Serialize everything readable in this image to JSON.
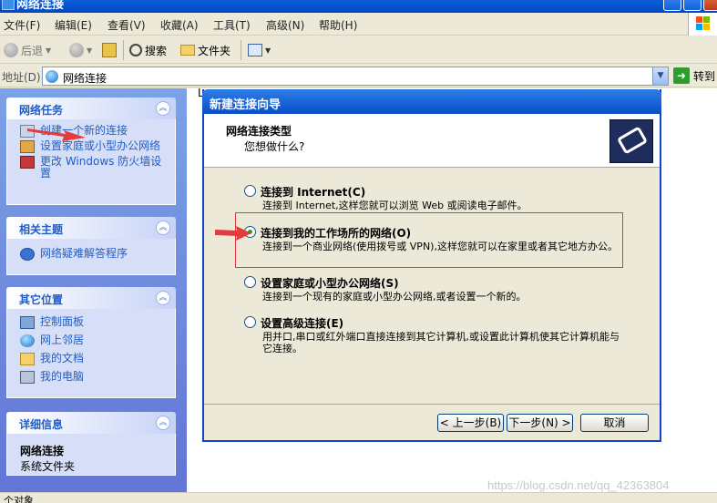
{
  "window": {
    "title": "网络连接"
  },
  "menubar": {
    "items": [
      "文件(F)",
      "编辑(E)",
      "查看(V)",
      "收藏(A)",
      "工具(T)",
      "高级(N)",
      "帮助(H)"
    ]
  },
  "toolbar": {
    "back_label": "后退",
    "search_label": "搜索",
    "folders_label": "文件夹"
  },
  "address": {
    "label": "地址(D)",
    "value": "网络连接",
    "go_label": "转到"
  },
  "left_pane": {
    "network_tasks": {
      "title": "网络任务",
      "items": [
        "创建一个新的连接",
        "设置家庭或小型办公网络",
        "更改 Windows 防火墙设置"
      ]
    },
    "related_topics": {
      "title": "相关主题",
      "items": [
        "网络疑难解答程序"
      ]
    },
    "other_places": {
      "title": "其它位置",
      "items": [
        "控制面板",
        "网上邻居",
        "我的文档",
        "我的电脑"
      ]
    },
    "details": {
      "title": "详细信息",
      "name": "网络连接",
      "type": "系统文件夹"
    }
  },
  "main": {
    "partial_text": "L"
  },
  "wizard": {
    "title": "新建连接向导",
    "header_title": "网络连接类型",
    "header_subtitle": "您想做什么?",
    "options": [
      {
        "label": "连接到 Internet(C)",
        "desc": "连接到 Internet,这样您就可以浏览 Web 或阅读电子邮件。",
        "selected": false
      },
      {
        "label": "连接到我的工作场所的网络(O)",
        "desc": "连接到一个商业网络(使用拨号或 VPN),这样您就可以在家里或者其它地方办公。",
        "selected": true
      },
      {
        "label": "设置家庭或小型办公网络(S)",
        "desc": "连接到一个现有的家庭或小型办公网络,或者设置一个新的。",
        "selected": false
      },
      {
        "label": "设置高级连接(E)",
        "desc": "用并口,串口或红外端口直接连接到其它计算机,或设置此计算机使其它计算机能与它连接。",
        "selected": false
      }
    ],
    "back_button": "< 上一步(B)",
    "next_button": "下一步(N) >",
    "cancel_button": "取消"
  },
  "statusbar": {
    "text": "个对象"
  },
  "watermark": "https://blog.csdn.net/qq_42363804",
  "colors": {
    "highlight_red": "#e03a3a",
    "xp_blue": "#0a4ec6",
    "task_link": "#215dc6"
  }
}
